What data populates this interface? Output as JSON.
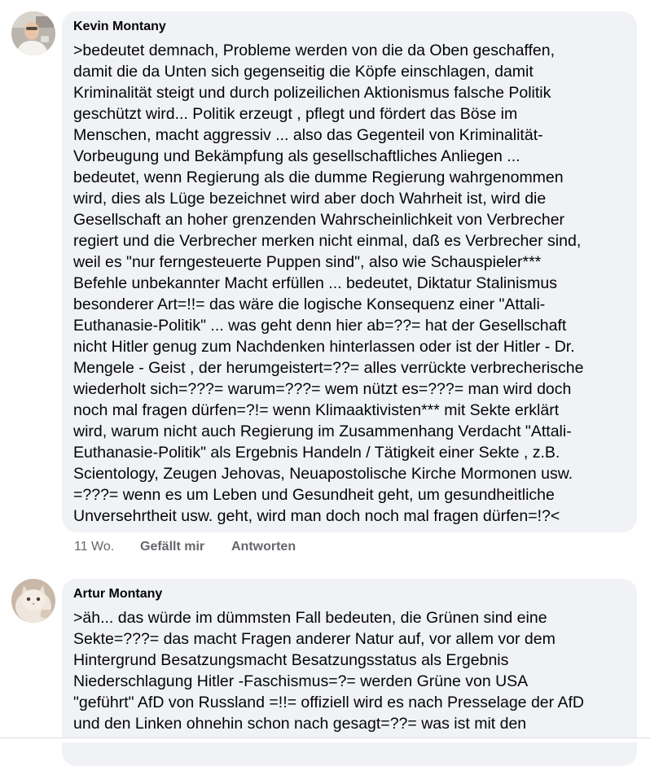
{
  "comments": [
    {
      "author": "Kevin Montany",
      "avatar_icon": "user-photo-avatar",
      "text": ">bedeutet demnach, Probleme werden von die da Oben geschaffen,\ndamit die da Unten sich gegenseitig die Köpfe einschlagen, damit\nKriminalität steigt und durch polizeilichen Aktionismus falsche Politik\ngeschützt wird... Politik erzeugt , pflegt und fördert das Böse im\nMenschen, macht aggressiv ... also das Gegenteil von Kriminalität-\nVorbeugung und Bekämpfung als gesellschaftliches Anliegen ...\nbedeutet, wenn Regierung als die dumme Regierung wahrgenommen\nwird, dies als Lüge bezeichnet wird aber doch Wahrheit ist, wird die\nGesellschaft an hoher grenzenden Wahrscheinlichkeit von Verbrecher\nregiert und die Verbrecher merken nicht einmal, daß es Verbrecher sind,\nweil es \"nur ferngesteuerte Puppen sind\", also  wie Schauspieler***\nBefehle unbekannter Macht erfüllen ... bedeutet, Diktatur Stalinismus\nbesonderer Art=!!= das wäre die logische Konsequenz einer \"Attali-\nEuthanasie-Politik\" ... was geht denn hier ab=??= hat der Gesellschaft\nnicht Hitler genug zum Nachdenken hinterlassen oder ist der Hitler - Dr.\nMengele - Geist  , der herumgeistert=??= alles verrückte verbrecherische\nwiederholt sich=???= warum=???= wem nützt es=???= man wird doch\nnoch mal fragen dürfen=?!= wenn Klimaaktivisten*** mit Sekte erklärt\nwird, warum nicht auch Regierung im Zusammenhang Verdacht  \"Attali-\nEuthanasie-Politik\" als Ergebnis Handeln / Tätigkeit  einer Sekte , z.B.\nScientology, Zeugen Jehovas, Neuapostolische Kirche Mormonen usw.\n=???= wenn es um Leben und Gesundheit geht, um gesundheitliche\nUnversehrtheit usw. geht, wird man doch noch mal fragen dürfen=!?<",
      "time": "11 Wo.",
      "like_label": "Gefällt mir",
      "reply_label": "Antworten"
    },
    {
      "author": "Artur Montany",
      "avatar_icon": "cat-photo-avatar",
      "text": ">äh... das würde im dümmsten Fall bedeuten, die Grünen sind eine\nSekte=???= das macht Fragen anderer Natur auf, vor allem vor dem\nHintergrund Besatzungsmacht Besatzungsstatus als Ergebnis\nNiederschlagung Hitler -Faschismus=?= werden Grüne von USA\n\"geführt\" AfD von Russland =!!= offiziell wird es nach Presselage der AfD\nund den Linken ohnehin schon nach gesagt=??= was ist mit den"
    }
  ],
  "colors": {
    "bubble": "#f0f2f5",
    "text": "#050505",
    "secondary": "#65676b"
  }
}
